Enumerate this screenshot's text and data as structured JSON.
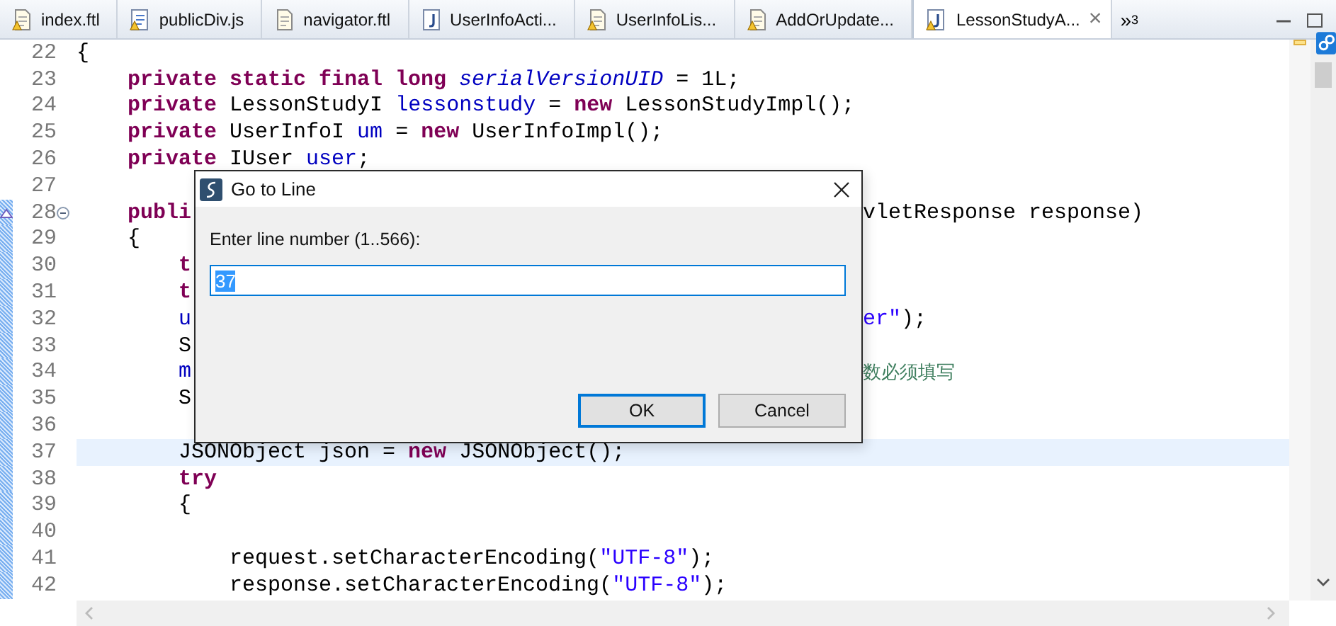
{
  "tabs": [
    {
      "label": "index.ftl",
      "kind": "file",
      "warning": true,
      "selected": false
    },
    {
      "label": "publicDiv.js",
      "kind": "script",
      "warning": true,
      "selected": false
    },
    {
      "label": "navigator.ftl",
      "kind": "file",
      "warning": false,
      "selected": false
    },
    {
      "label": "UserInfoActi...",
      "kind": "java",
      "warning": false,
      "selected": false
    },
    {
      "label": "UserInfoLis...",
      "kind": "file",
      "warning": true,
      "selected": false
    },
    {
      "label": "AddOrUpdate...",
      "kind": "file",
      "warning": true,
      "selected": false
    },
    {
      "label": "LessonStudyA...",
      "kind": "java",
      "warning": true,
      "selected": true
    }
  ],
  "tab_close": "×",
  "overflow": {
    "symbol": "»",
    "count": "3"
  },
  "editor": {
    "lines": [
      {
        "number": "22",
        "changed": false,
        "current": false,
        "fold": false,
        "override": false,
        "segments": [
          {
            "t": "{",
            "kind": "plain"
          }
        ]
      },
      {
        "number": "23",
        "changed": false,
        "current": false,
        "fold": false,
        "override": false,
        "segments": [
          {
            "t": "    private static final long",
            "kind": "keyword"
          },
          {
            "t": " serialVersionUID",
            "kind": "static_field"
          },
          {
            "t": " = 1L;",
            "kind": "plain"
          }
        ]
      },
      {
        "number": "24",
        "changed": false,
        "current": false,
        "fold": false,
        "override": false,
        "segments": [
          {
            "t": "    private",
            "kind": "keyword"
          },
          {
            "t": " LessonStudyI",
            "kind": "plain"
          },
          {
            "t": " lessonstudy",
            "kind": "field"
          },
          {
            "t": " =",
            "kind": "plain"
          },
          {
            "t": " new",
            "kind": "keyword"
          },
          {
            "t": " LessonStudyImpl();",
            "kind": "plain"
          }
        ]
      },
      {
        "number": "25",
        "changed": false,
        "current": false,
        "fold": false,
        "override": false,
        "segments": [
          {
            "t": "    private",
            "kind": "keyword"
          },
          {
            "t": " UserInfoI",
            "kind": "plain"
          },
          {
            "t": " um",
            "kind": "field"
          },
          {
            "t": " =",
            "kind": "plain"
          },
          {
            "t": " new",
            "kind": "keyword"
          },
          {
            "t": " UserInfoImpl();",
            "kind": "plain"
          }
        ]
      },
      {
        "number": "26",
        "changed": false,
        "current": false,
        "fold": false,
        "override": false,
        "segments": [
          {
            "t": "    private",
            "kind": "keyword"
          },
          {
            "t": " IUser",
            "kind": "plain"
          },
          {
            "t": " user",
            "kind": "field"
          },
          {
            "t": ";",
            "kind": "plain"
          }
        ]
      },
      {
        "number": "27",
        "changed": false,
        "current": false,
        "fold": false,
        "override": false
      },
      {
        "number": "28",
        "changed": true,
        "current": false,
        "fold": true,
        "override": true,
        "segments": [
          {
            "t": "    publi",
            "kind": "keyword"
          }
        ],
        "right": [
          {
            "t": "vletResponse response)",
            "kind": "plain"
          }
        ]
      },
      {
        "number": "29",
        "changed": true,
        "current": false,
        "fold": false,
        "override": false,
        "segments": [
          {
            "t": "    {",
            "kind": "plain"
          }
        ]
      },
      {
        "number": "30",
        "changed": true,
        "current": false,
        "fold": false,
        "override": false,
        "segments": [
          {
            "t": "        t",
            "kind": "keyword"
          }
        ]
      },
      {
        "number": "31",
        "changed": true,
        "current": false,
        "fold": false,
        "override": false,
        "segments": [
          {
            "t": "        t",
            "kind": "keyword"
          }
        ]
      },
      {
        "number": "32",
        "changed": true,
        "current": false,
        "fold": false,
        "override": false,
        "segments": [
          {
            "t": "        u",
            "kind": "field"
          }
        ],
        "right": [
          {
            "t": "er\"",
            "kind": "string"
          },
          {
            "t": ");",
            "kind": "plain"
          }
        ]
      },
      {
        "number": "33",
        "changed": true,
        "current": false,
        "fold": false,
        "override": false,
        "segments": [
          {
            "t": "        S",
            "kind": "plain"
          }
        ]
      },
      {
        "number": "34",
        "changed": true,
        "current": false,
        "fold": false,
        "override": false,
        "segments": [
          {
            "t": "        m",
            "kind": "field"
          }
        ],
        "right": [
          {
            "t": "数必须填写",
            "kind": "comment"
          }
        ]
      },
      {
        "number": "35",
        "changed": true,
        "current": false,
        "fold": false,
        "override": false,
        "segments": [
          {
            "t": "        S",
            "kind": "plain"
          }
        ]
      },
      {
        "number": "36",
        "changed": true,
        "current": false,
        "fold": false,
        "override": false
      },
      {
        "number": "37",
        "changed": true,
        "current": true,
        "fold": false,
        "override": false,
        "segments": [
          {
            "t": "        JSONObject json =",
            "kind": "plain"
          },
          {
            "t": " new",
            "kind": "keyword"
          },
          {
            "t": " JSONObject();",
            "kind": "plain"
          }
        ]
      },
      {
        "number": "38",
        "changed": true,
        "current": false,
        "fold": false,
        "override": false,
        "segments": [
          {
            "t": "        try",
            "kind": "keyword"
          }
        ]
      },
      {
        "number": "39",
        "changed": true,
        "current": false,
        "fold": false,
        "override": false,
        "segments": [
          {
            "t": "        {",
            "kind": "plain"
          }
        ]
      },
      {
        "number": "40",
        "changed": true,
        "current": false,
        "fold": false,
        "override": false
      },
      {
        "number": "41",
        "changed": true,
        "current": false,
        "fold": false,
        "override": false,
        "segments": [
          {
            "t": "            request.setCharacterEncoding(",
            "kind": "plain"
          },
          {
            "t": "\"UTF-8\"",
            "kind": "string"
          },
          {
            "t": ");",
            "kind": "plain"
          }
        ]
      },
      {
        "number": "42",
        "changed": true,
        "current": false,
        "fold": false,
        "override": false,
        "segments": [
          {
            "t": "            response.setCharacterEncoding(",
            "kind": "plain"
          },
          {
            "t": "\"UTF-8\"",
            "kind": "string"
          },
          {
            "t": ");",
            "kind": "plain"
          }
        ]
      }
    ]
  },
  "dialog": {
    "title": "Go to Line",
    "label": "Enter line number (1..566):",
    "value": "37",
    "value_selected": true,
    "buttons": [
      {
        "label": "OK",
        "default": true
      },
      {
        "label": "Cancel",
        "default": false
      }
    ]
  }
}
